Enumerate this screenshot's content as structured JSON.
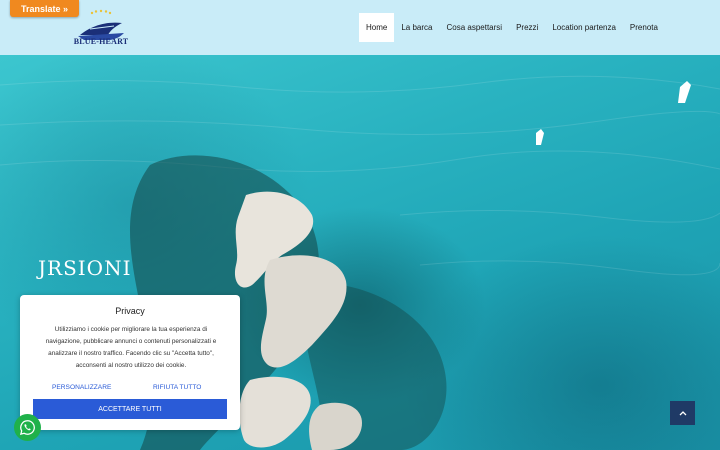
{
  "header": {
    "translate_label": "Translate »",
    "logo_text": "BLUE-HEART",
    "nav": [
      {
        "label": "Home"
      },
      {
        "label": "La barca"
      },
      {
        "label": "Cosa aspettarsi"
      },
      {
        "label": "Prezzi"
      },
      {
        "label": "Location partenza"
      },
      {
        "label": "Prenota"
      }
    ]
  },
  "hero": {
    "title": "JRSIONI"
  },
  "cookie": {
    "title": "Privacy",
    "body": "Utilizziamo i cookie per migliorare la tua esperienza di navigazione, pubblicare annunci o contenuti personalizzati e analizzare il nostro traffico. Facendo clic su \"Accetta tutto\", acconsenti al nostro utilizzo dei cookie.",
    "personalize_label": "PERSONALIZZARE",
    "reject_label": "RIFIUTA TUTTO",
    "accept_label": "ACCETTARE TUTTI"
  },
  "colors": {
    "header_bg": "#c9ecf8",
    "translate_orange": "#f0891f",
    "cookie_blue": "#2a5bd7",
    "whatsapp_green": "#1fb14a",
    "scroll_top_navy": "#1f3a66"
  },
  "icons": {
    "whatsapp": "whatsapp-icon",
    "scroll_top": "chevron-up-icon"
  }
}
